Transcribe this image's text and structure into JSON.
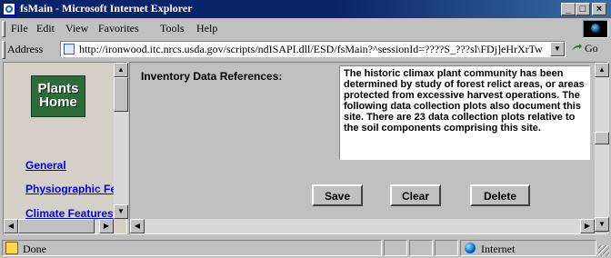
{
  "window": {
    "title": "fsMain - Microsoft Internet Explorer",
    "minimize": "_",
    "maximize": "□",
    "close": "×"
  },
  "menu": {
    "file": "File",
    "edit": "Edit",
    "view": "View",
    "favorites": "Favorites",
    "tools": "Tools",
    "help": "Help"
  },
  "address": {
    "label": "Address",
    "url": "http://ironwood.itc.nrcs.usda.gov/scripts/ndISAPI.dll/ESD/fsMain?^sessionId=????S_???sl\\FDj]eHrXrTw",
    "go": "Go"
  },
  "sidebar": {
    "logo_line1": "Plants",
    "logo_line2": "Home",
    "links": [
      "General",
      "Physiographic Fea",
      "Climate Features"
    ]
  },
  "form": {
    "label": "Inventory Data References:",
    "text": "The historic climax plant community has been determined by study of forest relict areas, or areas protected from excessive harvest operations. The following data collection plots also document this site.  There are 23 data collection plots relative to the soil components comprising this site.",
    "save": "Save",
    "clear": "Clear",
    "delete": "Delete"
  },
  "status": {
    "text": "Done",
    "zone": "Internet"
  }
}
